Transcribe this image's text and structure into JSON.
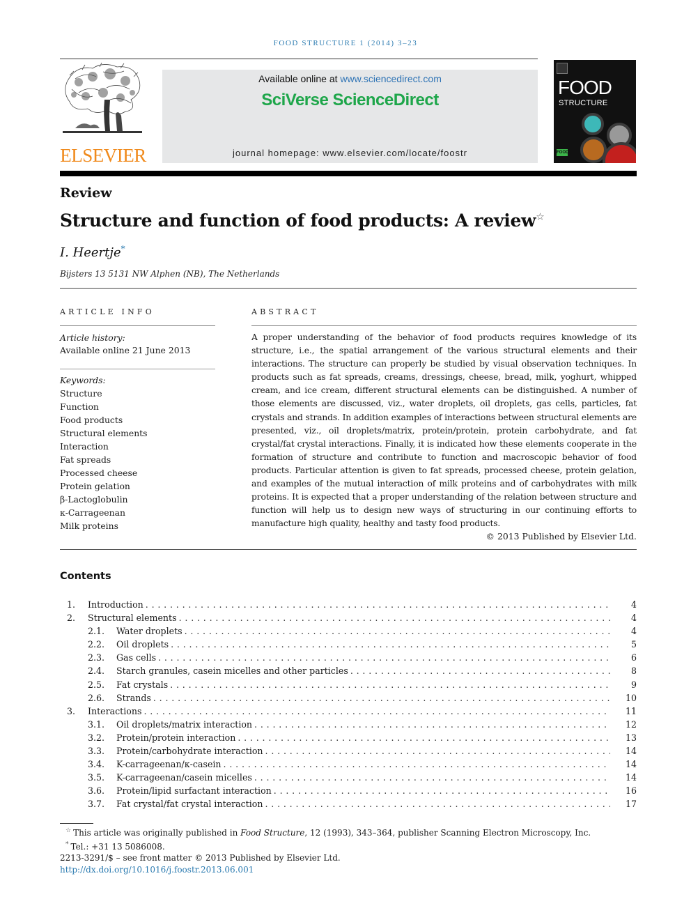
{
  "running_head": "FOOD STRUCTURE 1 (2014) 3–23",
  "publisher_logo": {
    "wordmark": "ELSEVIER",
    "icon": "elsevier-tree-icon",
    "color": "#f08a1c"
  },
  "sciencedirect_banner": {
    "available_prefix": "Available online at ",
    "available_link": "www.sciencedirect.com",
    "brand": "SciVerse ScienceDirect",
    "brand_color": "#1ea64a",
    "link_color": "#2f74b5",
    "homepage": "journal homepage: www.elsevier.com/locate/foostr"
  },
  "journal_cover": {
    "title_line1": "FOOD",
    "title_line2": "STRUCTURE",
    "logo_text": "FOOD"
  },
  "article": {
    "section_type": "Review",
    "title": "Structure and function of food products: A review",
    "title_note_mark": "☆",
    "author": "I. Heertje",
    "author_mark": "*",
    "affiliation": "Bijsters 13 5131 NW Alphen (NB), The Netherlands"
  },
  "article_info": {
    "heading": "ARTICLE INFO",
    "history_label": "Article history:",
    "history_value": "Available online 21 June 2013",
    "keywords_label": "Keywords:",
    "keywords": [
      "Structure",
      "Function",
      "Food products",
      "Structural elements",
      "Interaction",
      "Fat spreads",
      "Processed cheese",
      "Protein gelation",
      "β-Lactoglobulin",
      "κ-Carrageenan",
      "Milk proteins"
    ]
  },
  "abstract": {
    "heading": "ABSTRACT",
    "text": "A proper understanding of the behavior of food products requires knowledge of its structure, i.e., the spatial arrangement of the various structural elements and their interactions. The structure can properly be studied by visual observation techniques. In products such as fat spreads, creams, dressings, cheese, bread, milk, yoghurt, whipped cream, and ice cream, different structural elements can be distinguished. A number of those elements are discussed, viz., water droplets, oil droplets, gas cells, particles, fat crystals and strands. In addition examples of interactions between structural elements are presented, viz., oil droplets/matrix, protein/protein, protein carbohydrate, and fat crystal/fat crystal interactions. Finally, it is indicated how these elements cooperate in the formation of structure and contribute to function and macroscopic behavior of food products. Particular attention is given to fat spreads, processed cheese, protein gelation, and examples of the mutual interaction of milk proteins and of carbohydrates with milk proteins. It is expected that a proper understanding of the relation between structure and function will help us to design new ways of structuring in our continuing efforts to manufacture high quality, healthy and tasty food products.",
    "copyright": "© 2013 Published by Elsevier Ltd."
  },
  "contents": {
    "heading": "Contents",
    "entries": [
      {
        "num": "1.",
        "title": "Introduction",
        "page": "4",
        "level": 1
      },
      {
        "num": "2.",
        "title": "Structural elements",
        "page": "4",
        "level": 1
      },
      {
        "num": "2.1.",
        "title": "Water droplets",
        "page": "4",
        "level": 2
      },
      {
        "num": "2.2.",
        "title": "Oil droplets",
        "page": "5",
        "level": 2
      },
      {
        "num": "2.3.",
        "title": "Gas cells",
        "page": "6",
        "level": 2
      },
      {
        "num": "2.4.",
        "title": "Starch granules, casein micelles and other particles",
        "page": "8",
        "level": 2
      },
      {
        "num": "2.5.",
        "title": "Fat crystals",
        "page": "9",
        "level": 2
      },
      {
        "num": "2.6.",
        "title": "Strands",
        "page": "10",
        "level": 2
      },
      {
        "num": "3.",
        "title": "Interactions",
        "page": "11",
        "level": 1
      },
      {
        "num": "3.1.",
        "title": "Oil droplets/matrix interaction",
        "page": "12",
        "level": 2
      },
      {
        "num": "3.2.",
        "title": "Protein/protein interaction",
        "page": "13",
        "level": 2
      },
      {
        "num": "3.3.",
        "title": "Protein/carbohydrate interaction",
        "page": "14",
        "level": 2
      },
      {
        "num": "3.4.",
        "title": "K-carrageenan/κ-casein",
        "page": "14",
        "level": 2
      },
      {
        "num": "3.5.",
        "title": "K-carrageenan/casein micelles",
        "page": "14",
        "level": 2
      },
      {
        "num": "3.6.",
        "title": "Protein/lipid surfactant interaction",
        "page": "16",
        "level": 2
      },
      {
        "num": "3.7.",
        "title": "Fat crystal/fat crystal interaction",
        "page": "17",
        "level": 2
      }
    ]
  },
  "footnotes": {
    "fn1_mark": "☆",
    "fn1_prefix": "This article was originally published in ",
    "fn1_journal": "Food Structure",
    "fn1_suffix": ", 12 (1993), 343–364, publisher Scanning Electron Microscopy, Inc.",
    "fn2_mark": "*",
    "fn2_text": "Tel.: +31 13 5086008.",
    "front_matter": "2213-3291/$ – see front matter © 2013 Published by Elsevier Ltd.",
    "doi": "http://dx.doi.org/10.1016/j.foostr.2013.06.001"
  }
}
